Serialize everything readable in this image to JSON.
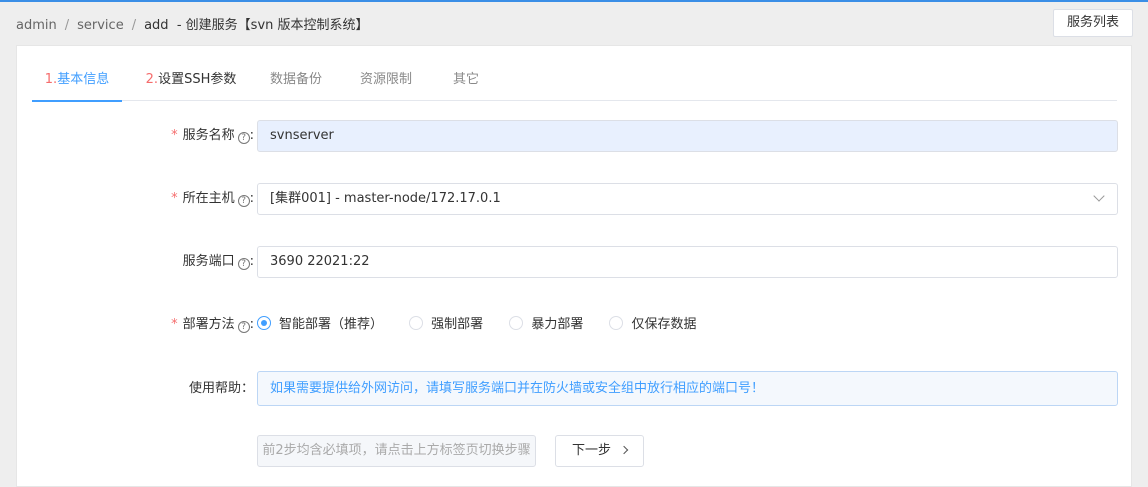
{
  "breadcrumb": {
    "items": [
      "admin",
      "service",
      "add"
    ],
    "separator": "/",
    "title_suffix": "- 创建服务【svn 版本控制系统】"
  },
  "header": {
    "list_button": "服务列表"
  },
  "tabs": [
    {
      "num": "1.",
      "label": "基本信息",
      "active": true
    },
    {
      "num": "2.",
      "label": "设置SSH参数",
      "active": false
    },
    {
      "num": "",
      "label": "数据备份",
      "active": false
    },
    {
      "num": "",
      "label": "资源限制",
      "active": false
    },
    {
      "num": "",
      "label": "其它",
      "active": false
    }
  ],
  "form": {
    "service_name": {
      "label": "服务名称",
      "required": true,
      "value": "svnserver"
    },
    "host": {
      "label": "所在主机",
      "required": true,
      "value": "[集群001] - master-node/172.17.0.1"
    },
    "port": {
      "label": "服务端口",
      "required": false,
      "value": "3690 22021:22"
    },
    "deploy": {
      "label": "部署方法",
      "required": true,
      "options": [
        "智能部署（推荐）",
        "强制部署",
        "暴力部署",
        "仅保存数据"
      ],
      "selected": 0
    },
    "help": {
      "label": "使用帮助：",
      "text": "如果需要提供给外网访问，请填写服务端口并在防火墙或安全组中放行相应的端口号！"
    }
  },
  "colon": ":",
  "required_mark": "*",
  "help_glyph": "?",
  "actions": {
    "prev_label": "前2步均含必填项，请点击上方标签页切换步骤",
    "next_label": "下一步"
  },
  "colors": {
    "accent": "#409eff",
    "required": "#f56c6c"
  }
}
